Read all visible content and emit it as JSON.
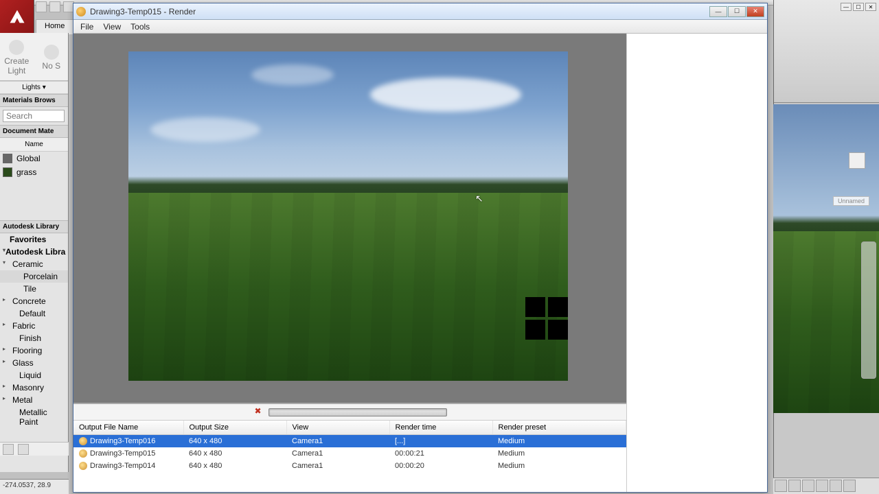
{
  "app": {
    "home_tab": "Home",
    "coords": "-274.0537,  28.9"
  },
  "left_panel": {
    "create_light": "Create\nLight",
    "no_s": "No S",
    "lights_drop": "Lights ▾",
    "browser_title": "Materials Brows",
    "search_placeholder": "Search",
    "doc_mat_title": "Document Mate",
    "name_header": "Name",
    "materials": [
      {
        "name": "Global",
        "color": "#666"
      },
      {
        "name": "grass",
        "color": "#2a4a1a"
      }
    ],
    "lib_title": "Autodesk Library",
    "favorites": "Favorites",
    "autodesk_lib": "Autodesk Libra",
    "tree": {
      "ceramic": "Ceramic",
      "porcelain": "Porcelain",
      "tile": "Tile",
      "concrete": "Concrete",
      "default": "Default",
      "fabric": "Fabric",
      "finish": "Finish",
      "flooring": "Flooring",
      "glass": "Glass",
      "liquid": "Liquid",
      "masonry": "Masonry",
      "metal": "Metal",
      "metallic_paint": "Metallic Paint"
    }
  },
  "render_window": {
    "title": "Drawing3-Temp015 - Render",
    "menu": {
      "file": "File",
      "view": "View",
      "tools": "Tools"
    },
    "history": {
      "columns": {
        "output_file": "Output File Name",
        "output_size": "Output Size",
        "view": "View",
        "render_time": "Render time",
        "render_preset": "Render preset"
      },
      "rows": [
        {
          "file": "Drawing3-Temp016",
          "size": "640 x 480",
          "view": "Camera1",
          "time": "[...]",
          "preset": "Medium",
          "selected": true
        },
        {
          "file": "Drawing3-Temp015",
          "size": "640 x 480",
          "view": "Camera1",
          "time": "00:00:21",
          "preset": "Medium",
          "selected": false
        },
        {
          "file": "Drawing3-Temp014",
          "size": "640 x 480",
          "view": "Camera1",
          "time": "00:00:20",
          "preset": "Medium",
          "selected": false
        }
      ]
    }
  },
  "side_window": {
    "tag": "Unnamed"
  }
}
